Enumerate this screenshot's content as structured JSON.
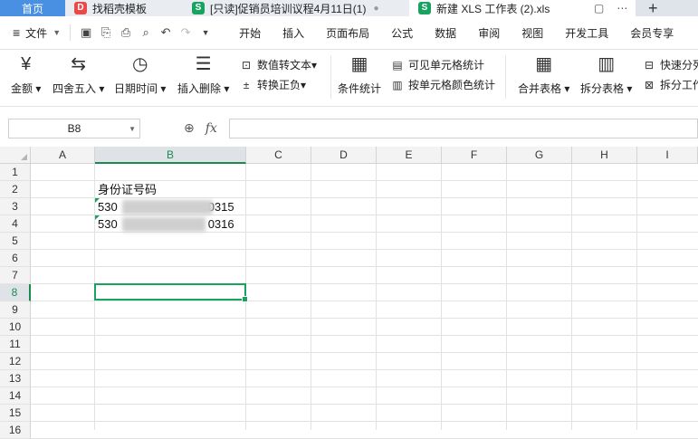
{
  "tabs": {
    "home": "首页",
    "t1": "找稻壳模板",
    "t2": "[只读]促销员培训议程4月11日(1)",
    "t3": "新建 XLS 工作表 (2).xls"
  },
  "menubar": {
    "file": "文件",
    "items": [
      "开始",
      "插入",
      "页面布局",
      "公式",
      "数据",
      "审阅",
      "视图",
      "开发工具",
      "会员专享"
    ]
  },
  "ribbon": {
    "amount": "金额",
    "round": "四舍五入",
    "datetime": "日期时间",
    "insert_delete": "插入删除",
    "num_to_text": "数值转文本",
    "convert_sign": "转换正负",
    "cond_stats": "条件统计",
    "visible_stats": "可见单元格统计",
    "color_stats": "按单元格颜色统计",
    "merge": "合并表格",
    "split": "拆分表格",
    "fast_split": "快速分列",
    "split_ws": "拆分工作"
  },
  "formula": {
    "namebox": "B8",
    "fx": "fx",
    "content": ""
  },
  "grid": {
    "columns": [
      "A",
      "B",
      "C",
      "D",
      "E",
      "F",
      "G",
      "H",
      "I"
    ],
    "rows": [
      "1",
      "2",
      "3",
      "4",
      "5",
      "6",
      "7",
      "8",
      "9",
      "10",
      "11",
      "12",
      "13",
      "14",
      "15",
      "16"
    ],
    "selected_column": "B",
    "selected_row": "8",
    "cells": {
      "b2": "身份证号码",
      "b3_prefix": "530",
      "b3_suffix": "0315",
      "b4_prefix": "530",
      "b4_suffix": "0316"
    }
  },
  "colors": {
    "accent": "#1aa260",
    "home_tab": "#4a90e2"
  }
}
